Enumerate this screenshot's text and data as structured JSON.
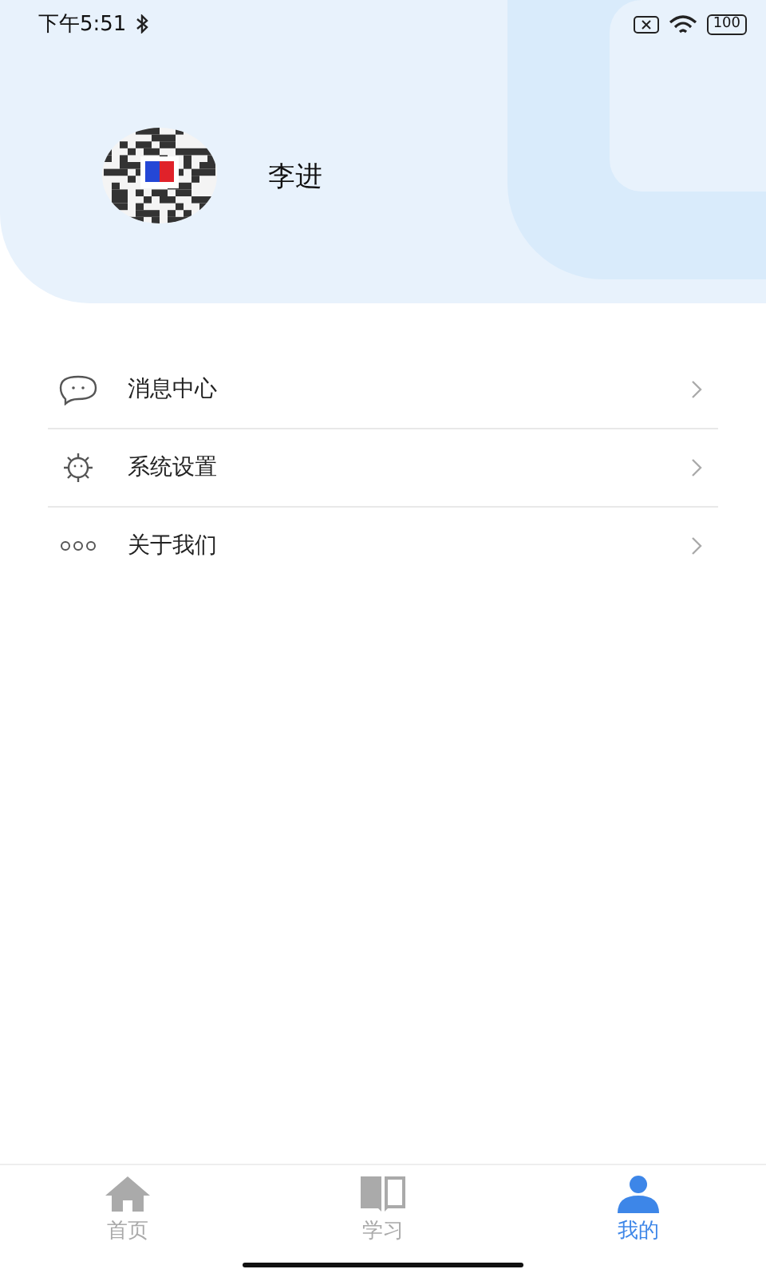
{
  "status_bar": {
    "time": "下午5:51",
    "battery": "100"
  },
  "profile": {
    "name": "李进"
  },
  "menu": [
    {
      "kind": "chat",
      "label": "消息中心"
    },
    {
      "kind": "settings",
      "label": "系统设置"
    },
    {
      "kind": "more",
      "label": "关于我们"
    }
  ],
  "tabs": [
    {
      "kind": "home",
      "label": "首页",
      "selected": false
    },
    {
      "kind": "book",
      "label": "学习",
      "selected": false
    },
    {
      "kind": "person",
      "label": "我的",
      "selected": true
    }
  ]
}
